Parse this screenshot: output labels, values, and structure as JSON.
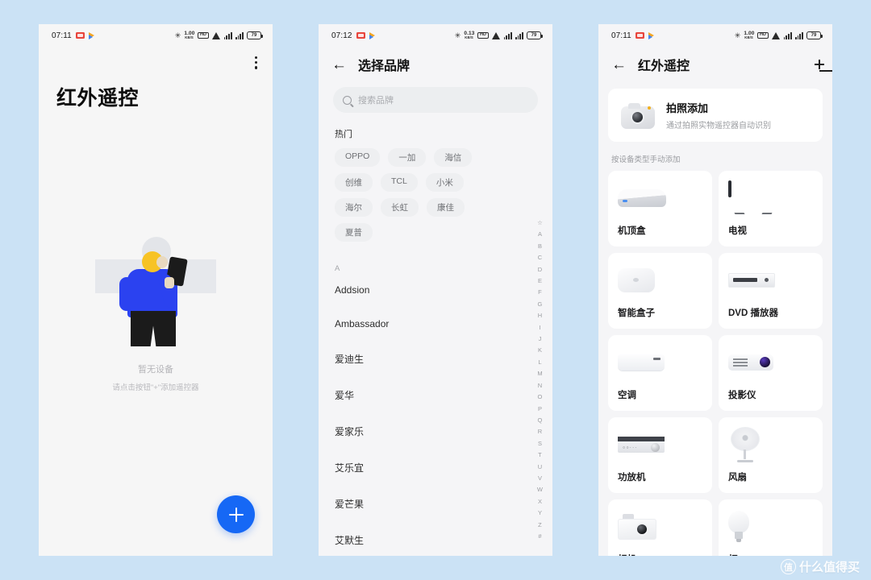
{
  "colors": {
    "background": "#cbe2f5",
    "accent": "#1668f5",
    "panel": "#f6f6f6",
    "card": "#ffffff"
  },
  "statusbars": [
    {
      "time": "07:11",
      "speed_value": "1.00",
      "speed_unit": "KB/S",
      "battery": "79",
      "hd_label": "HD"
    },
    {
      "time": "07:12",
      "speed_value": "0.13",
      "speed_unit": "KB/S",
      "battery": "79",
      "hd_label": "HD"
    },
    {
      "time": "07:11",
      "speed_value": "1.00",
      "speed_unit": "KB/S",
      "battery": "79",
      "hd_label": "HD"
    }
  ],
  "panel1": {
    "title": "红外遥控",
    "menu_icon": "overflow-menu-icon",
    "empty_title": "暂无设备",
    "empty_hint": "请点击按钮\"+\"添加遥控器",
    "fab_label": "+"
  },
  "panel2": {
    "nav_title": "选择品牌",
    "back_icon": "back-arrow-icon",
    "search": {
      "placeholder": "搜索品牌",
      "value": ""
    },
    "hot_label": "热门",
    "hot_brands": [
      "OPPO",
      "一加",
      "海信",
      "创维",
      "TCL",
      "小米",
      "海尔",
      "长虹",
      "康佳",
      "夏普"
    ],
    "list_section": "A",
    "brands": [
      "Addsion",
      "Ambassador",
      "爱迪生",
      "爱华",
      "爱家乐",
      "艾乐宜",
      "爱芒果",
      "艾默生"
    ],
    "alpha_index": [
      "☆",
      "A",
      "B",
      "C",
      "D",
      "E",
      "F",
      "G",
      "H",
      "I",
      "J",
      "K",
      "L",
      "M",
      "N",
      "O",
      "P",
      "Q",
      "R",
      "S",
      "T",
      "U",
      "V",
      "W",
      "X",
      "Y",
      "Z",
      "#"
    ]
  },
  "panel3": {
    "nav_title": "红外遥控",
    "back_icon": "back-arrow-icon",
    "scan_icon": "scan-icon",
    "photo_card": {
      "title": "拍照添加",
      "subtitle": "通过拍照实物遥控器自动识别",
      "icon": "camera-icon"
    },
    "section_label": "按设备类型手动添加",
    "devices": [
      {
        "label": "机顶盒",
        "icon": "set-top-box-icon"
      },
      {
        "label": "电视",
        "icon": "tv-icon"
      },
      {
        "label": "智能盒子",
        "icon": "smart-box-icon"
      },
      {
        "label": "DVD 播放器",
        "icon": "dvd-player-icon"
      },
      {
        "label": "空调",
        "icon": "air-conditioner-icon"
      },
      {
        "label": "投影仪",
        "icon": "projector-icon"
      },
      {
        "label": "功放机",
        "icon": "amplifier-icon"
      },
      {
        "label": "风扇",
        "icon": "fan-icon"
      },
      {
        "label": "相机",
        "icon": "camera-device-icon"
      },
      {
        "label": "灯",
        "icon": "light-bulb-icon"
      }
    ]
  },
  "watermark": {
    "mark": "值",
    "text": "什么值得买"
  }
}
